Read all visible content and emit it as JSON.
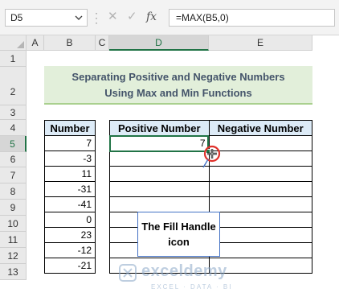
{
  "formula_bar": {
    "name_box": "D5",
    "fx_symbol": "fx",
    "formula": "=MAX(B5,0)"
  },
  "columns": [
    "A",
    "B",
    "C",
    "D",
    "E"
  ],
  "rows": [
    "1",
    "2",
    "3",
    "4",
    "5",
    "6",
    "7",
    "8",
    "9",
    "10",
    "11",
    "12",
    "13"
  ],
  "title": {
    "line1": "Separating Positive and Negative Numbers",
    "line2": "Using Max and Min Functions"
  },
  "number_table": {
    "header": "Number",
    "values": [
      "7",
      "-3",
      "11",
      "-31",
      "-41",
      "0",
      "23",
      "-12",
      "-21"
    ]
  },
  "result_table": {
    "header_positive": "Positive Number",
    "header_negative": "Negative Number",
    "first_positive": "7"
  },
  "callout": {
    "line1": "The Fill Handle",
    "line2": "icon"
  },
  "watermark": {
    "brand": "exceldemy",
    "tagline": "EXCEL · DATA · BI"
  },
  "colors": {
    "accent": "#217346",
    "title_bg": "#e2efda",
    "header_bg": "#ddebf7",
    "callout_border": "#4472c4",
    "pointer": "#e0302a"
  }
}
